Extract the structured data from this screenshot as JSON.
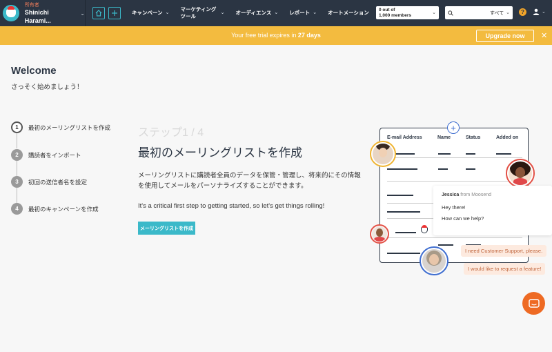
{
  "app": {
    "owner_label": "所有者",
    "account_name": "Shinichi Harami..."
  },
  "nav": {
    "items": [
      {
        "label": "キャンペーン"
      },
      {
        "label": "マーケティングツール"
      },
      {
        "label": "オーディエンス"
      },
      {
        "label": "レポート"
      },
      {
        "label": "オートメーション"
      }
    ],
    "members_line1": "0 out of",
    "members_line2": "1,000 members",
    "search_scope": "すべて",
    "help_glyph": "?"
  },
  "trial": {
    "text_prefix": "Your free trial expires in",
    "days": "27 days",
    "upgrade_label": "Upgrade now",
    "close_glyph": "✕"
  },
  "welcome": {
    "title": "Welcome",
    "subtitle": "さっそく始めましょう！"
  },
  "steps": [
    {
      "num": "1",
      "label": "最初のメーリングリストを作成",
      "active": true
    },
    {
      "num": "2",
      "label": "購読者をインポート",
      "active": false
    },
    {
      "num": "3",
      "label": "初回の送信者名を設定",
      "active": false
    },
    {
      "num": "4",
      "label": "最初のキャンペーンを作成",
      "active": false
    }
  ],
  "main": {
    "step_counter": "ステップ1 / 4",
    "title": "最初のメーリングリストを作成",
    "description": "メーリングリストに購読者全員のデータを保管・管理し、将来的にその情報を使用してメールをパーソナライズすることができます。",
    "english_line": "It's a critical first step to getting started, so let's get things rolling!",
    "button_label": "メーリングリストを作成"
  },
  "illustration": {
    "columns": [
      "E-mail Address",
      "Name",
      "Status",
      "Added on"
    ],
    "chat_agent": "Jessica",
    "chat_from": "from Moosend",
    "chat_messages": [
      "Hey there!",
      "How can we help?"
    ],
    "user_messages": [
      "I need Customer Support, please.",
      "I would like to request a feature!"
    ]
  },
  "colors": {
    "nav_bg": "#2b3543",
    "accent_teal": "#3bb9c9",
    "trial_yellow": "#f3bb3f",
    "messenger_orange": "#ee6a23"
  }
}
